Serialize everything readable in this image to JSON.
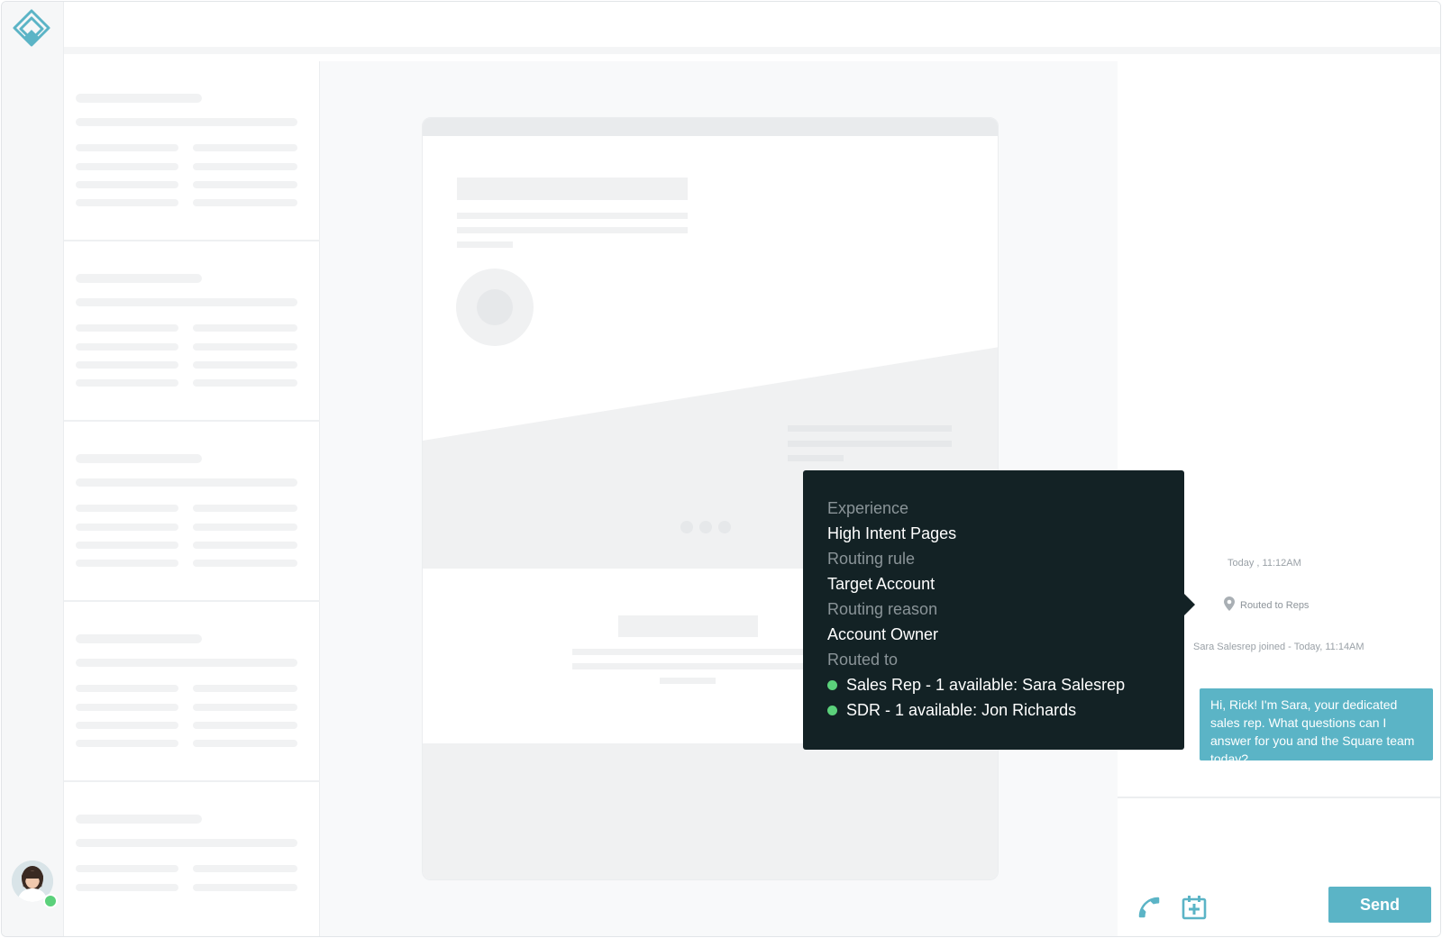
{
  "brand": {
    "accent": "#5bb4c6",
    "online": "#5bd17b",
    "tooltip_bg": "#132225"
  },
  "nav": {
    "logo_icon": "diamond-logo-icon",
    "avatar_icon": "user-avatar"
  },
  "chat": {
    "timestamp": "Today , 11:12AM",
    "routed_label": "Routed to Reps",
    "joined_text": "Sara Salesrep joined - Today, 11:14AM",
    "message": "Hi, Rick! I'm Sara, your dedicated sales rep. What questions can I answer for you and the Square team today?",
    "send_label": "Send",
    "phone_icon": "phone-icon",
    "calendar_icon": "calendar-add-icon"
  },
  "tooltip": {
    "experience_label": "Experience",
    "experience_value": "High Intent Pages",
    "rule_label": "Routing rule",
    "rule_value": "Target Account",
    "reason_label": "Routing reason",
    "reason_value": "Account Owner",
    "routed_to_label": "Routed to",
    "routed_items": [
      "Sales Rep - 1 available: Sara Salesrep",
      "SDR - 1 available: Jon Richards"
    ]
  }
}
